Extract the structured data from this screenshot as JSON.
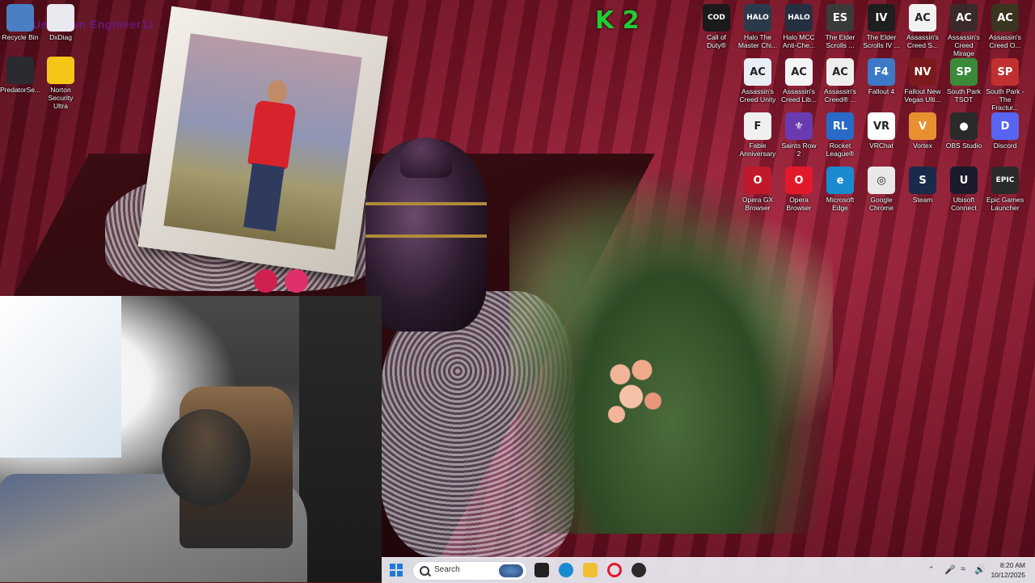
{
  "desktop": {
    "overlay_text": "Unknown Engineer11",
    "k2_logo": "K 2",
    "icons_left": [
      {
        "label": "Recycle Bin",
        "icon": "recycle-bin-icon",
        "color": "#4a7ec2"
      },
      {
        "label": "DxDiag",
        "icon": "document-icon",
        "color": "#e8e8ee"
      },
      {
        "label": "PredatorSe...",
        "icon": "predator-icon",
        "color": "#2a2a30"
      },
      {
        "label": "Norton\nSecurity Ultra",
        "icon": "norton-icon",
        "color": "#f5c518"
      }
    ],
    "icons_grid": [
      {
        "label": "Call of\nDuty®",
        "icon": "call-of-duty-icon",
        "glyph": "COD",
        "color": "#1a1a1a"
      },
      {
        "label": "Halo The\nMaster Chi...",
        "icon": "halo-icon",
        "glyph": "HALO",
        "color": "#2a3a4a"
      },
      {
        "label": "Halo MCC\nAnti-Che...",
        "icon": "halo-mcc-icon",
        "glyph": "HALO",
        "color": "#243040"
      },
      {
        "label": "The Elder\nScrolls ...",
        "icon": "elder-scrolls-icon",
        "glyph": "ES",
        "color": "#3a3a3a"
      },
      {
        "label": "The Elder\nScrolls IV ...",
        "icon": "oblivion-icon",
        "glyph": "IV",
        "color": "#1e1e1e"
      },
      {
        "label": "Assassin's\nCreed S...",
        "icon": "assassins-creed-icon",
        "glyph": "AC",
        "color": "#f2f2f2"
      },
      {
        "label": "Assassin's\nCreed Mirage",
        "icon": "ac-mirage-icon",
        "glyph": "AC",
        "color": "#3a2a2a"
      },
      {
        "label": "Assassin's\nCreed O...",
        "icon": "ac-origins-icon",
        "glyph": "AC",
        "color": "#3a3420"
      },
      {
        "label": "Assassin's\nCreed Unity",
        "icon": "ac-unity-icon",
        "glyph": "AC",
        "color": "#e8eef4"
      },
      {
        "label": "Assassin's\nCreed Lib...",
        "icon": "ac-liberation-icon",
        "glyph": "AC",
        "color": "#f4f4f4"
      },
      {
        "label": "Assassin's\nCreed® ...",
        "icon": "ac-generic-icon",
        "glyph": "AC",
        "color": "#eeeeee"
      },
      {
        "label": "Fallout 4",
        "icon": "fallout4-icon",
        "glyph": "F4",
        "color": "#3c7ac8"
      },
      {
        "label": "Fallout New\nVegas Ulti...",
        "icon": "fallout-nv-icon",
        "glyph": "NV",
        "color": "#7a1a1a"
      },
      {
        "label": "South Park\nTSOT",
        "icon": "south-park-icon",
        "glyph": "SP",
        "color": "#3a8a3a"
      },
      {
        "label": "South Park -\nThe Fractur...",
        "icon": "south-park-fbw-icon",
        "glyph": "SP",
        "color": "#c03030"
      },
      {
        "label": "Fable\nAnniversary",
        "icon": "fable-icon",
        "glyph": "F",
        "color": "#f0f0f0"
      },
      {
        "label": "Saints Row 2",
        "icon": "saints-row-icon",
        "glyph": "⚜",
        "color": "#6a3ab0"
      },
      {
        "label": "Rocket\nLeague®",
        "icon": "rocket-league-icon",
        "glyph": "RL",
        "color": "#2a6ac8"
      },
      {
        "label": "VRChat",
        "icon": "vrchat-icon",
        "glyph": "VR",
        "color": "#ffffff"
      },
      {
        "label": "Vortex",
        "icon": "vortex-icon",
        "glyph": "V",
        "color": "#e89030"
      },
      {
        "label": "OBS Studio",
        "icon": "obs-icon",
        "glyph": "●",
        "color": "#2a2a2a"
      },
      {
        "label": "Discord",
        "icon": "discord-icon",
        "glyph": "D",
        "color": "#5865f2"
      },
      {
        "label": "Opera GX\nBrowser",
        "icon": "opera-gx-icon",
        "glyph": "O",
        "color": "#c01a2a"
      },
      {
        "label": "Opera\nBrowser",
        "icon": "opera-icon",
        "glyph": "O",
        "color": "#e01a2a"
      },
      {
        "label": "Microsoft\nEdge",
        "icon": "edge-icon",
        "glyph": "e",
        "color": "#1a8ad0"
      },
      {
        "label": "Google\nChrome",
        "icon": "chrome-icon",
        "glyph": "◎",
        "color": "#e8e8e8"
      },
      {
        "label": "Steam",
        "icon": "steam-icon",
        "glyph": "S",
        "color": "#1a2a4a"
      },
      {
        "label": "Ubisoft\nConnect",
        "icon": "ubisoft-icon",
        "glyph": "U",
        "color": "#1a1a2a"
      },
      {
        "label": "Epic Games\nLauncher",
        "icon": "epic-icon",
        "glyph": "EPIC",
        "color": "#2a2a2a"
      }
    ]
  },
  "taskbar": {
    "search_placeholder": "Search",
    "apps": [
      {
        "icon": "task-view-icon",
        "color": "#222222"
      },
      {
        "icon": "edge-taskbar-icon",
        "color": "#1a8ad0"
      },
      {
        "icon": "file-explorer-icon",
        "color": "#f0c030"
      },
      {
        "icon": "opera-taskbar-icon",
        "color": "#e01a2a"
      },
      {
        "icon": "obs-taskbar-icon",
        "color": "#2a2a2a"
      }
    ],
    "time": "8:20 AM",
    "date": "10/12/2025"
  }
}
